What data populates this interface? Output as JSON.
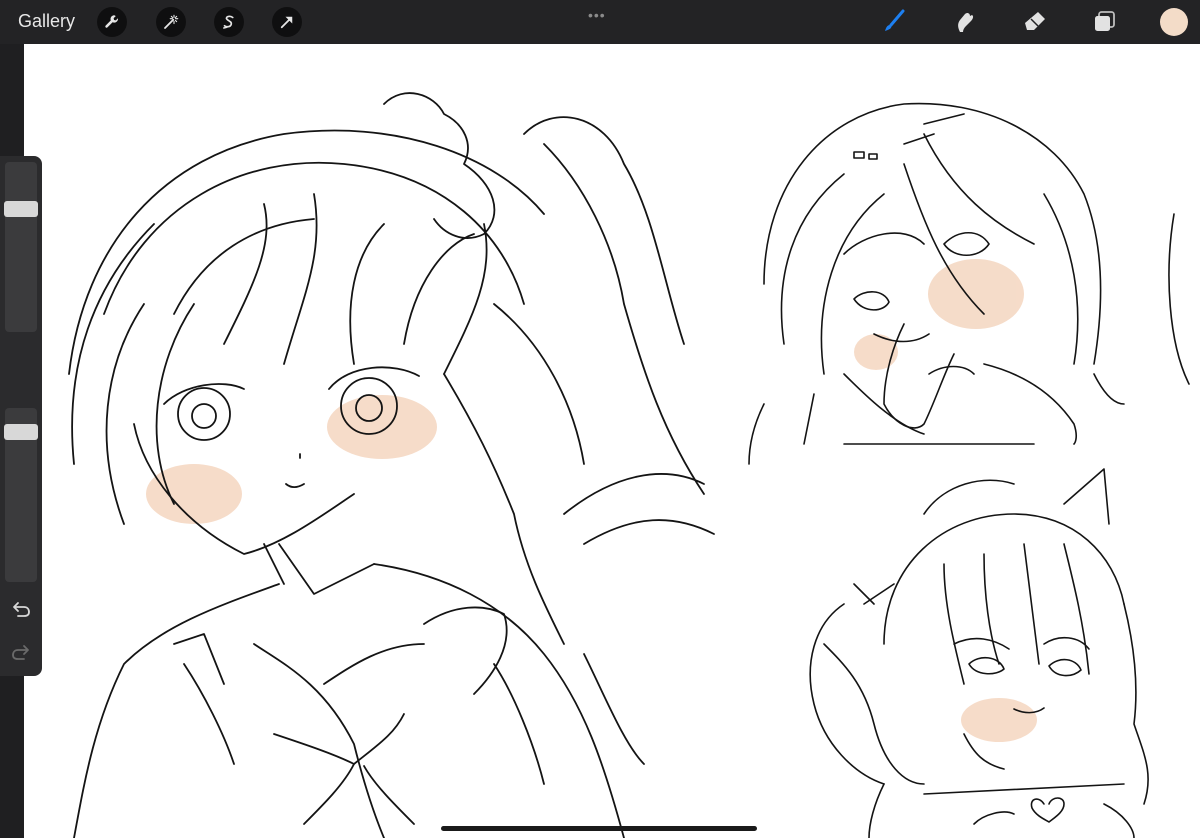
{
  "toolbar": {
    "gallery_label": "Gallery",
    "left_icons": [
      "wrench-icon",
      "magic-wand-icon",
      "selection-s-icon",
      "transform-arrow-icon"
    ],
    "grabber_glyph": "•••",
    "right_icons": [
      "brush-icon",
      "smudge-icon",
      "eraser-icon",
      "layers-icon"
    ],
    "active_tool": "brush-icon",
    "current_color": "#f3dcc8",
    "active_tool_color": "#1d7ff0"
  },
  "sidebar": {
    "brush_size_level": 0.75,
    "opacity_level": 0.9,
    "modify_button": "square-modify-icon",
    "undo_icon": "undo-icon",
    "redo_icon": "redo-icon"
  },
  "canvas": {
    "background": "#ffffff",
    "ink_color": "#141414",
    "blush_color": "#f4d6c0"
  }
}
